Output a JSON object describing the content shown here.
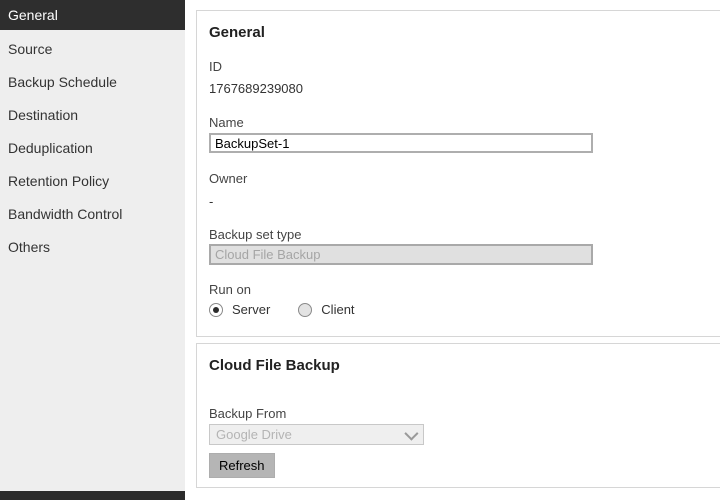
{
  "sidebar": {
    "items": [
      {
        "label": "General",
        "selected": true
      },
      {
        "label": "Source",
        "selected": false
      },
      {
        "label": "Backup Schedule",
        "selected": false
      },
      {
        "label": "Destination",
        "selected": false
      },
      {
        "label": "Deduplication",
        "selected": false
      },
      {
        "label": "Retention Policy",
        "selected": false
      },
      {
        "label": "Bandwidth Control",
        "selected": false
      },
      {
        "label": "Others",
        "selected": false
      }
    ]
  },
  "general_panel": {
    "title": "General",
    "id_label": "ID",
    "id_value": "1767689239080",
    "name_label": "Name",
    "name_value": "BackupSet-1",
    "owner_label": "Owner",
    "owner_value": "-",
    "backup_set_type_label": "Backup set type",
    "backup_set_type_value": "Cloud File Backup",
    "run_on_label": "Run on",
    "run_on_options": [
      {
        "label": "Server",
        "selected": true
      },
      {
        "label": "Client",
        "selected": false
      }
    ]
  },
  "cloud_panel": {
    "title": "Cloud File Backup",
    "backup_from_label": "Backup From",
    "backup_from_value": "Google Drive",
    "refresh_label": "Refresh"
  },
  "colors": {
    "sidebar_bg": "#eeeeee",
    "sidebar_selected_bg": "#2e2e2e",
    "sidebar_selected_text": "#ffffff",
    "panel_border": "#d6d6d6",
    "disabled_field_bg": "#e0e0e0",
    "disabled_field_text": "#a5a5a5",
    "button_bg": "#b5b5b5"
  }
}
